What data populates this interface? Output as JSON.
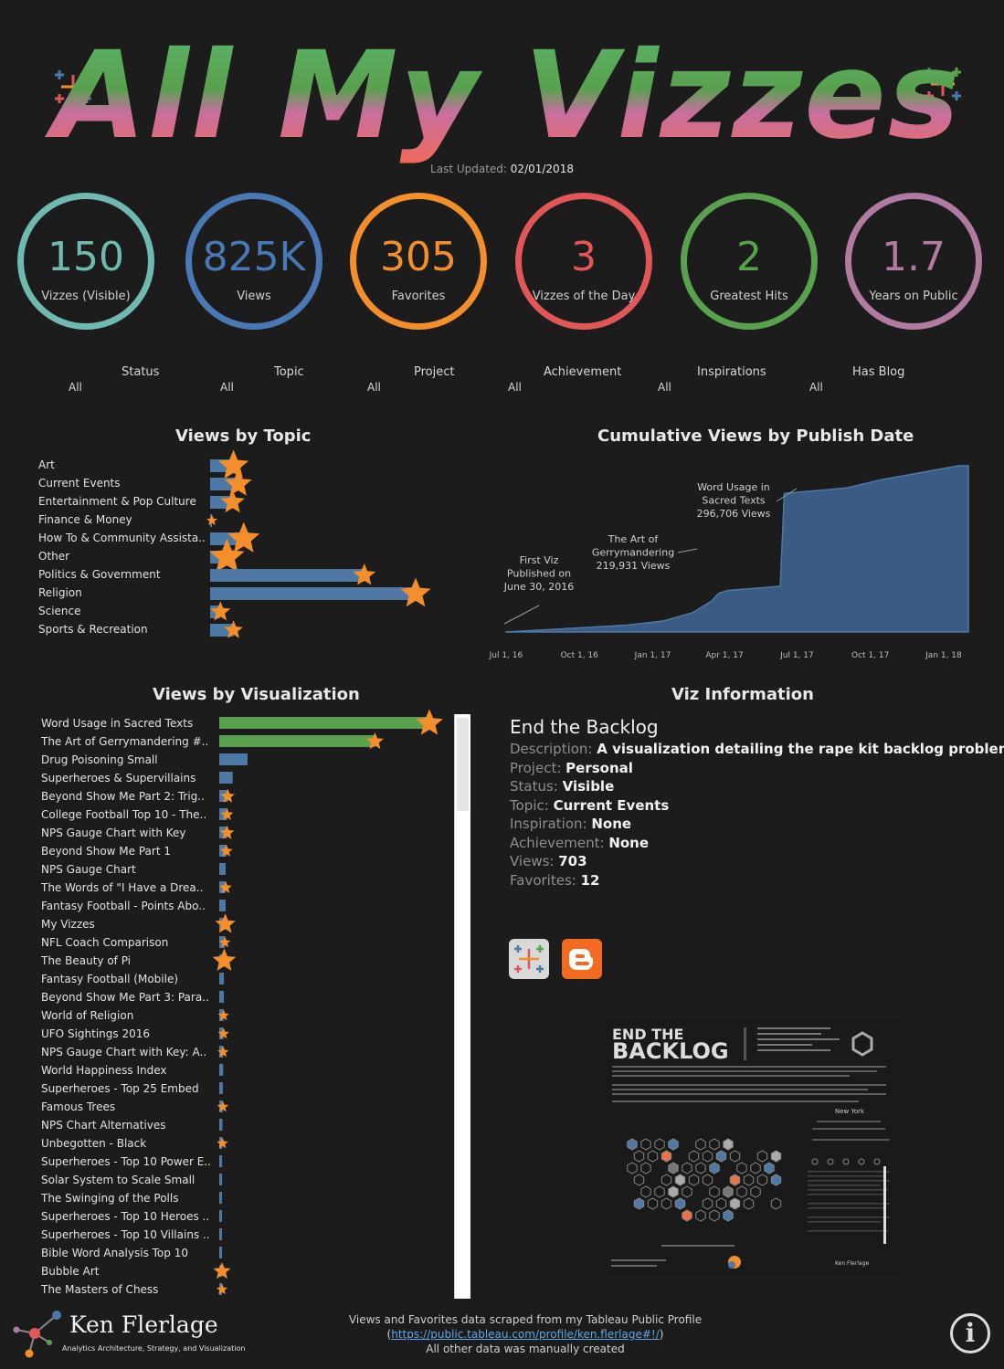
{
  "header": {
    "title": "All My Vizzes",
    "last_updated_label": "Last Updated:",
    "last_updated_value": "02/01/2018"
  },
  "kpis": [
    {
      "value": "150",
      "label": "Vizzes (Visible)",
      "color": "#6fb9b0"
    },
    {
      "value": "825K",
      "label": "Views",
      "color": "#4a78b4"
    },
    {
      "value": "305",
      "label": "Favorites",
      "color": "#f28e2b"
    },
    {
      "value": "3",
      "label": "Vizzes of the Day",
      "color": "#e15759"
    },
    {
      "value": "2",
      "label": "Greatest Hits",
      "color": "#59a14f"
    },
    {
      "value": "1.7",
      "label": "Years on Public",
      "color": "#b07aa1"
    }
  ],
  "filters": [
    {
      "name": "Status",
      "value": "All"
    },
    {
      "name": "Topic",
      "value": "All"
    },
    {
      "name": "Project",
      "value": "All"
    },
    {
      "name": "Achievement",
      "value": "All"
    },
    {
      "name": "Inspirations",
      "value": "All"
    },
    {
      "name": "Has Blog",
      "value": "All"
    }
  ],
  "views_by_topic": {
    "title": "Views by Topic",
    "chart_data": {
      "type": "bar",
      "categories": [
        "Art",
        "Current Events",
        "Entertainment & Pop Culture",
        "Finance & Money",
        "How To & Community Assista..",
        "Other",
        "Politics & Government",
        "Religion",
        "Science",
        "Sports & Recreation"
      ],
      "series": [
        {
          "name": "Views",
          "values": [
            25,
            30,
            24,
            1,
            36,
            18,
            165,
            220,
            11,
            25
          ]
        },
        {
          "name": "Favorites",
          "values": [
            3,
            2.6,
            2.2,
            0.5,
            3.2,
            3.6,
            2,
            3,
            1.7,
            1.5
          ]
        }
      ]
    }
  },
  "cumulative_views": {
    "title": "Cumulative Views by Publish Date",
    "x_ticks": [
      "Jul 1, 16",
      "Oct 1, 16",
      "Jan 1, 17",
      "Apr 1, 17",
      "Jul 1, 17",
      "Oct 1, 17",
      "Jan 1, 18"
    ],
    "annotations": [
      {
        "lines": [
          "First Viz",
          "Published on",
          "June 30, 2016"
        ]
      },
      {
        "lines": [
          "The Art of",
          "Gerrymandering",
          "219,931 Views"
        ]
      },
      {
        "lines": [
          "Word Usage in",
          "Sacred Texts",
          "296,706 Views"
        ]
      }
    ],
    "chart_data": {
      "type": "area",
      "x": [
        "2016-06-30",
        "2016-09-01",
        "2016-12-01",
        "2017-01-15",
        "2017-02-20",
        "2017-03-15",
        "2017-03-25",
        "2017-04-05",
        "2017-05-20",
        "2017-06-10",
        "2017-06-15",
        "2017-09-01",
        "2017-10-15",
        "2018-01-20"
      ],
      "y": [
        0,
        10000,
        25000,
        40000,
        70000,
        110000,
        140000,
        150000,
        160000,
        165000,
        500000,
        520000,
        550000,
        600000
      ]
    }
  },
  "views_by_viz": {
    "title": "Views by Visualization",
    "chart_data": {
      "type": "bar",
      "categories": [
        "Word Usage in Sacred Texts",
        "The Art of Gerrymandering #..",
        "Drug Poisoning Small",
        "Superheroes & Supervillains",
        "Beyond Show Me Part 2: Trig..",
        "College Football Top 10 - The..",
        "NPS Gauge Chart  with Key",
        "Beyond Show Me Part 1",
        "NPS Gauge Chart",
        "The Words of \"I Have a Drea..",
        "Fantasy Football - Points Abo..",
        "My Vizzes",
        "NFL Coach Comparison",
        "The Beauty of Pi",
        "Fantasy Football (Mobile)",
        "Beyond Show Me Part 3: Para..",
        "World of Religion",
        "UFO Sightings 2016",
        "NPS Gauge Chart with Key: A..",
        "World Happiness Index",
        "Superheroes - Top 25 Embed",
        "Famous  Trees",
        "NPS Chart Alternatives",
        "Unbegotten - Black",
        "Superheroes - Top 10 Power E..",
        "Solar System to  Scale Small",
        "The Swinging of the  Polls",
        "Superheroes - Top 10 Heroes ..",
        "Superheroes - Top 10 Villains ..",
        "Bible Word Analysis Top 10",
        "Bubble Art",
        "The Masters of Chess"
      ],
      "series": [
        {
          "name": "Views",
          "values": [
            296706,
            219931,
            40000,
            19000,
            12000,
            11000,
            11000,
            10000,
            9000,
            9000,
            9000,
            8500,
            8000,
            7000,
            6500,
            6500,
            6000,
            6000,
            5500,
            5500,
            5000,
            5000,
            4500,
            4500,
            4000,
            4000,
            3500,
            3500,
            3500,
            3000,
            2500,
            2500
          ]
        },
        {
          "name": "Favorites",
          "values": [
            3.6,
            2,
            0,
            0,
            1.5,
            1.2,
            1.5,
            1.2,
            0,
            1.2,
            0,
            2.5,
            1,
            3,
            0,
            0,
            1,
            1,
            1,
            0,
            0,
            1,
            0,
            1,
            0,
            0,
            0,
            0,
            0,
            0,
            2,
            1
          ]
        }
      ],
      "highlight_color": "#59a14f",
      "bar_color": "#4e79a7",
      "star_color": "#f28e2b"
    }
  },
  "viz_info": {
    "title": "Viz Information",
    "viz_name": "End the Backlog",
    "rows": [
      {
        "key": "Description:",
        "value": "A visualization detailing the rape kit backlog problem."
      },
      {
        "key": "Project:",
        "value": "Personal"
      },
      {
        "key": "Status:",
        "value": "Visible"
      },
      {
        "key": "Topic:",
        "value": "Current Events"
      },
      {
        "key": "Inspiration:",
        "value": "None"
      },
      {
        "key": "Achievement:",
        "value": "None"
      },
      {
        "key": "Views:",
        "value": "703"
      },
      {
        "key": "Favorites:",
        "value": "12"
      }
    ],
    "thumbnail_title_1": "END THE",
    "thumbnail_title_2": "BACKLOG",
    "thumbnail_state": "New York"
  },
  "icons": {
    "tableau": "tableau-logo-icon",
    "blogger": "blogger-icon",
    "info": "info-icon"
  },
  "footer": {
    "logo_name": "Ken Flerlage",
    "logo_tagline": "Analytics Architecture, Strategy, and Visualization",
    "line1": "Views and Favorites data scraped from my Tableau Public Profile",
    "link": "https://public.tableau.com/profile/ken.flerlage#!/",
    "line3": "All other data was manually created"
  }
}
